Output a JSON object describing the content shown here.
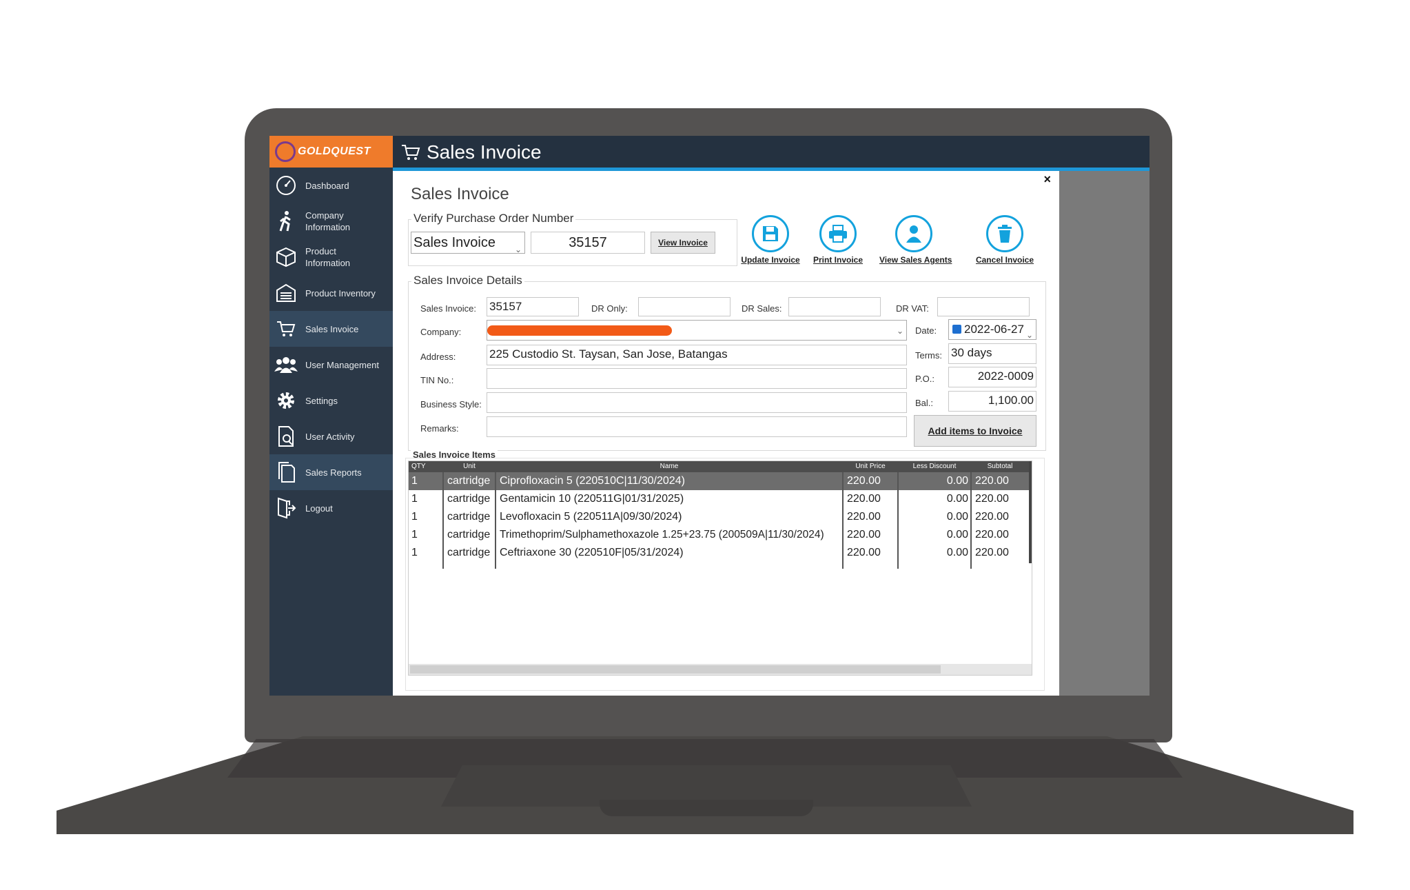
{
  "app": {
    "brand": "GOLDQUEST",
    "window_title": "Sales Invoice",
    "accent_color": "#1e97d8",
    "brand_color": "#ef7b2b"
  },
  "sidebar": {
    "items": [
      {
        "label": "Dashboard",
        "icon": "dashboard-icon"
      },
      {
        "label": "Company\nInformation",
        "icon": "walking-person-icon"
      },
      {
        "label": "Product\nInformation",
        "icon": "box-icon"
      },
      {
        "label": "Product Inventory",
        "icon": "warehouse-icon"
      },
      {
        "label": "Sales Invoice",
        "icon": "cart-icon"
      },
      {
        "label": "User Management",
        "icon": "users-icon"
      },
      {
        "label": "Settings",
        "icon": "gear-icon"
      },
      {
        "label": "User Activity",
        "icon": "document-search-icon"
      },
      {
        "label": "Sales Reports",
        "icon": "documents-icon"
      },
      {
        "label": "Logout",
        "icon": "logout-icon"
      }
    ],
    "active": "Sales Invoice"
  },
  "panel": {
    "title": "Sales Invoice",
    "close": "×"
  },
  "verify": {
    "group_title": "Verify Purchase Order Number",
    "type_value": "Sales Invoice",
    "number_value": "35157",
    "view_button": "View Invoice"
  },
  "actions": {
    "update": "Update Invoice",
    "print": "Print Invoice",
    "agents": "View Sales Agents",
    "cancel": "Cancel Invoice"
  },
  "details": {
    "group_title": "Sales Invoice Details",
    "sales_invoice_label": "Sales Invoice:",
    "sales_invoice_value": "35157",
    "dr_only_label": "DR Only:",
    "dr_only_value": "",
    "dr_sales_label": "DR Sales:",
    "dr_sales_value": "",
    "dr_vat_label": "DR VAT:",
    "dr_vat_value": "",
    "company_label": "Company:",
    "date_label": "Date:",
    "date_value": "2022-06-27",
    "address_label": "Address:",
    "address_value": "225 Custodio St. Taysan, San Jose, Batangas",
    "terms_label": "Terms:",
    "terms_value": "30 days",
    "tin_label": "TIN No.:",
    "tin_value": "",
    "po_label": "P.O.:",
    "po_value": "2022-0009",
    "business_style_label": "Business Style:",
    "business_style_value": "",
    "bal_label": "Bal.:",
    "bal_value": "1,100.00",
    "remarks_label": "Remarks:",
    "remarks_value": "",
    "add_items_button": "Add items to Invoice"
  },
  "items": {
    "group_title": "Sales Invoice Items",
    "columns": [
      "QTY",
      "Unit",
      "Name",
      "Unit Price",
      "Less Discount",
      "Subtotal"
    ],
    "rows": [
      {
        "qty": "1",
        "unit": "cartridge",
        "name": "Ciprofloxacin 5 (220510C|11/30/2024)",
        "price": "220.00",
        "discount": "0.00",
        "subtotal": "220.00"
      },
      {
        "qty": "1",
        "unit": "cartridge",
        "name": "Gentamicin 10 (220511G|01/31/2025)",
        "price": "220.00",
        "discount": "0.00",
        "subtotal": "220.00"
      },
      {
        "qty": "1",
        "unit": "cartridge",
        "name": "Levofloxacin 5 (220511A|09/30/2024)",
        "price": "220.00",
        "discount": "0.00",
        "subtotal": "220.00"
      },
      {
        "qty": "1",
        "unit": "cartridge",
        "name": "Trimethoprim/Sulphamethoxazole 1.25+23.75 (200509A|11/30/2024)",
        "price": "220.00",
        "discount": "0.00",
        "subtotal": "220.00"
      },
      {
        "qty": "1",
        "unit": "cartridge",
        "name": "Ceftriaxone 30 (220510F|05/31/2024)",
        "price": "220.00",
        "discount": "0.00",
        "subtotal": "220.00"
      }
    ]
  }
}
